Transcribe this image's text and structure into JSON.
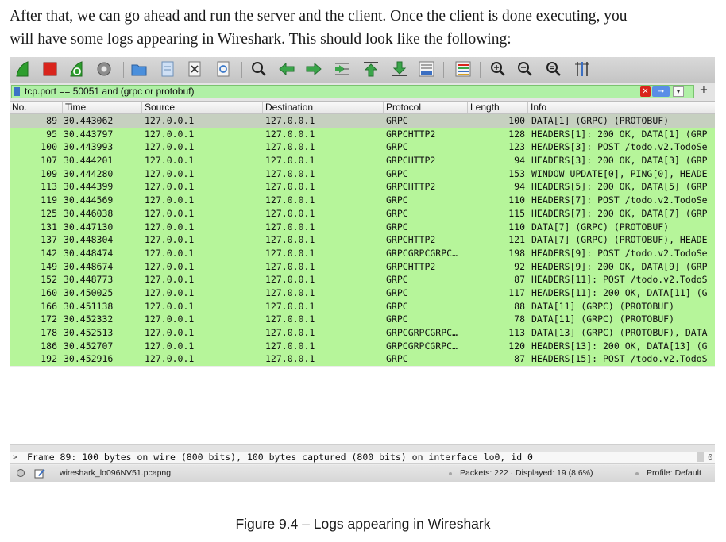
{
  "intro_text": {
    "line1": "After that, we can go ahead and run the server and the client. Once the client is done executing, you",
    "line2": "will have some logs appearing in Wireshark. This should look like the following:"
  },
  "toolbar": {
    "icons": [
      "shark-fin-start-icon",
      "stop-square-icon",
      "restart-capture-icon",
      "capture-options-gear-icon",
      "open-folder-icon",
      "save-file-icon",
      "close-file-icon",
      "reload-file-icon",
      "find-packet-icon",
      "go-back-arrow-icon",
      "go-forward-arrow-icon",
      "go-to-packet-icon",
      "first-packet-icon",
      "last-packet-icon",
      "auto-scroll-icon",
      "colorize-icon",
      "zoom-in-icon",
      "zoom-out-icon",
      "normal-size-icon",
      "resize-columns-icon"
    ],
    "colors": {
      "fin": "#2e9e2e",
      "stop": "#d9241c",
      "arrow": "#3aa54a",
      "folder": "#4a8fdc"
    }
  },
  "filter": {
    "value": "tcp.port == 50051 and (grpc or protobuf)",
    "color": "#b0f0a6",
    "clear_glyph": "✕",
    "apply_glyph": "→",
    "dropdown_glyph": "▾",
    "add_glyph": "+"
  },
  "packet_list": {
    "columns": [
      "No.",
      "Time",
      "Source",
      "Destination",
      "Protocol",
      "Length",
      "Info"
    ],
    "row_color": "#b6f59a",
    "selected_row_color": "#c6d0c0",
    "rows": [
      {
        "no": "89",
        "time": "30.443062",
        "src": "127.0.0.1",
        "dst": "127.0.0.1",
        "proto": "GRPC",
        "len": "100",
        "info": "DATA[1] (GRPC) (PROTOBUF)"
      },
      {
        "no": "95",
        "time": "30.443797",
        "src": "127.0.0.1",
        "dst": "127.0.0.1",
        "proto": "GRPCHTTP2",
        "len": "128",
        "info": "HEADERS[1]: 200 OK, DATA[1] (GRP"
      },
      {
        "no": "100",
        "time": "30.443993",
        "src": "127.0.0.1",
        "dst": "127.0.0.1",
        "proto": "GRPC",
        "len": "123",
        "info": "HEADERS[3]: POST /todo.v2.TodoSe"
      },
      {
        "no": "107",
        "time": "30.444201",
        "src": "127.0.0.1",
        "dst": "127.0.0.1",
        "proto": "GRPCHTTP2",
        "len": "94",
        "info": "HEADERS[3]: 200 OK, DATA[3] (GRP"
      },
      {
        "no": "109",
        "time": "30.444280",
        "src": "127.0.0.1",
        "dst": "127.0.0.1",
        "proto": "GRPC",
        "len": "153",
        "info": "WINDOW_UPDATE[0], PING[0], HEADE"
      },
      {
        "no": "113",
        "time": "30.444399",
        "src": "127.0.0.1",
        "dst": "127.0.0.1",
        "proto": "GRPCHTTP2",
        "len": "94",
        "info": "HEADERS[5]: 200 OK, DATA[5] (GRP"
      },
      {
        "no": "119",
        "time": "30.444569",
        "src": "127.0.0.1",
        "dst": "127.0.0.1",
        "proto": "GRPC",
        "len": "110",
        "info": "HEADERS[7]: POST /todo.v2.TodoSe"
      },
      {
        "no": "125",
        "time": "30.446038",
        "src": "127.0.0.1",
        "dst": "127.0.0.1",
        "proto": "GRPC",
        "len": "115",
        "info": "HEADERS[7]: 200 OK, DATA[7] (GRP"
      },
      {
        "no": "131",
        "time": "30.447130",
        "src": "127.0.0.1",
        "dst": "127.0.0.1",
        "proto": "GRPC",
        "len": "110",
        "info": "DATA[7] (GRPC) (PROTOBUF)"
      },
      {
        "no": "137",
        "time": "30.448304",
        "src": "127.0.0.1",
        "dst": "127.0.0.1",
        "proto": "GRPCHTTP2",
        "len": "121",
        "info": "DATA[7] (GRPC) (PROTOBUF), HEADE"
      },
      {
        "no": "142",
        "time": "30.448474",
        "src": "127.0.0.1",
        "dst": "127.0.0.1",
        "proto": "GRPCGRPCGRPC…",
        "len": "198",
        "info": "HEADERS[9]: POST /todo.v2.TodoSe"
      },
      {
        "no": "149",
        "time": "30.448674",
        "src": "127.0.0.1",
        "dst": "127.0.0.1",
        "proto": "GRPCHTTP2",
        "len": "92",
        "info": "HEADERS[9]: 200 OK, DATA[9] (GRP"
      },
      {
        "no": "152",
        "time": "30.448773",
        "src": "127.0.0.1",
        "dst": "127.0.0.1",
        "proto": "GRPC",
        "len": "87",
        "info": "HEADERS[11]: POST /todo.v2.TodoS"
      },
      {
        "no": "160",
        "time": "30.450025",
        "src": "127.0.0.1",
        "dst": "127.0.0.1",
        "proto": "GRPC",
        "len": "117",
        "info": "HEADERS[11]: 200 OK, DATA[11] (G"
      },
      {
        "no": "166",
        "time": "30.451138",
        "src": "127.0.0.1",
        "dst": "127.0.0.1",
        "proto": "GRPC",
        "len": "88",
        "info": "DATA[11] (GRPC) (PROTOBUF)"
      },
      {
        "no": "172",
        "time": "30.452332",
        "src": "127.0.0.1",
        "dst": "127.0.0.1",
        "proto": "GRPC",
        "len": "78",
        "info": "DATA[11] (GRPC) (PROTOBUF)"
      },
      {
        "no": "178",
        "time": "30.452513",
        "src": "127.0.0.1",
        "dst": "127.0.0.1",
        "proto": "GRPCGRPCGRPC…",
        "len": "113",
        "info": "DATA[13] (GRPC) (PROTOBUF), DATA"
      },
      {
        "no": "186",
        "time": "30.452707",
        "src": "127.0.0.1",
        "dst": "127.0.0.1",
        "proto": "GRPCGRPCGRPC…",
        "len": "120",
        "info": "HEADERS[13]: 200 OK, DATA[13] (G"
      },
      {
        "no": "192",
        "time": "30.452916",
        "src": "127.0.0.1",
        "dst": "127.0.0.1",
        "proto": "GRPC",
        "len": "87",
        "info": "HEADERS[15]: POST /todo.v2.TodoS"
      }
    ]
  },
  "detail": {
    "expander": ">",
    "frame_text": "Frame 89: 100 bytes on wire (800 bits), 100 bytes captured (800 bits) on interface lo0, id 0",
    "bytes_stub": "0"
  },
  "status_bar": {
    "filename": "wireshark_lo096NV51.pcapng",
    "packets": "Packets: 222 · Displayed: 19 (8.6%)",
    "profile": "Profile: Default"
  },
  "caption": "Figure 9.4 – Logs appearing in Wireshark"
}
